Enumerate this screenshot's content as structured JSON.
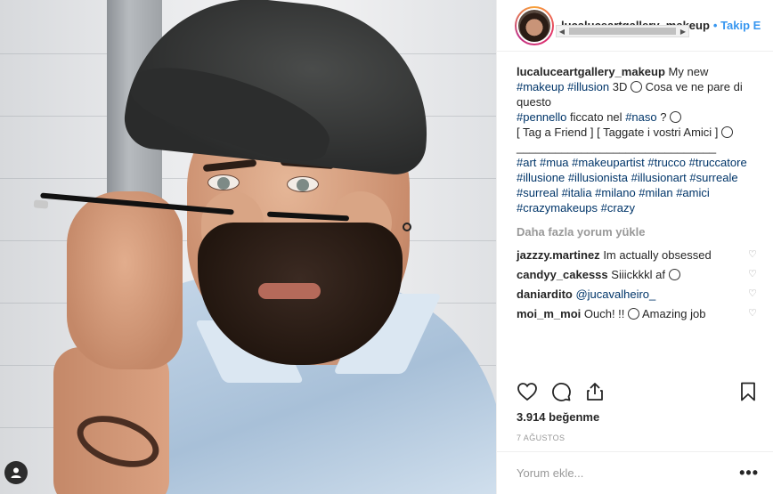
{
  "post": {
    "username": "lucaluceartgallery_makeup",
    "follow_label": "• Takip E",
    "caption": {
      "username": "lucaluceartgallery_makeup",
      "line1_text": "My new",
      "tag_makeup": "#makeup",
      "tag_illusion": "#illusion",
      "line2_text": "3D",
      "line2_rest": "Cosa ve ne pare di questo",
      "tag_pennello": "#pennello",
      "line3_text": "ficcato nel",
      "tag_naso": "#naso",
      "line3_rest": "?",
      "line4_text": "[ Tag a Friend ] [ Taggate i vostri Amici ]",
      "divider": "_______________________________",
      "hashtags": "#art #mua #makeupartist #trucco #truccatore #illusione #illusionista #illusionart #surreale #surreal #italia #milano #milan #amici #crazymakeups #crazy"
    },
    "load_more": "Daha fazla yorum yükle",
    "comments": [
      {
        "user": "jazzzy.martinez",
        "text": "Im actually obsessed"
      },
      {
        "user": "candyy_cakesss",
        "text": "Siiickkkl af"
      },
      {
        "user": "daniardito",
        "text": "@jucavalheiro_"
      },
      {
        "user": "moi_m_moi",
        "text": "Ouch! !!",
        "text2": "Amazing job"
      }
    ],
    "likes": "3.914 beğenme",
    "date": "7 AĞUSTOS",
    "comment_placeholder": "Yorum ekle...",
    "more_label": "•••"
  },
  "icons": {
    "heart": "heart-icon",
    "comment": "comment-icon",
    "share": "share-icon",
    "save": "bookmark-icon",
    "user_tag": "user-tag-icon"
  }
}
